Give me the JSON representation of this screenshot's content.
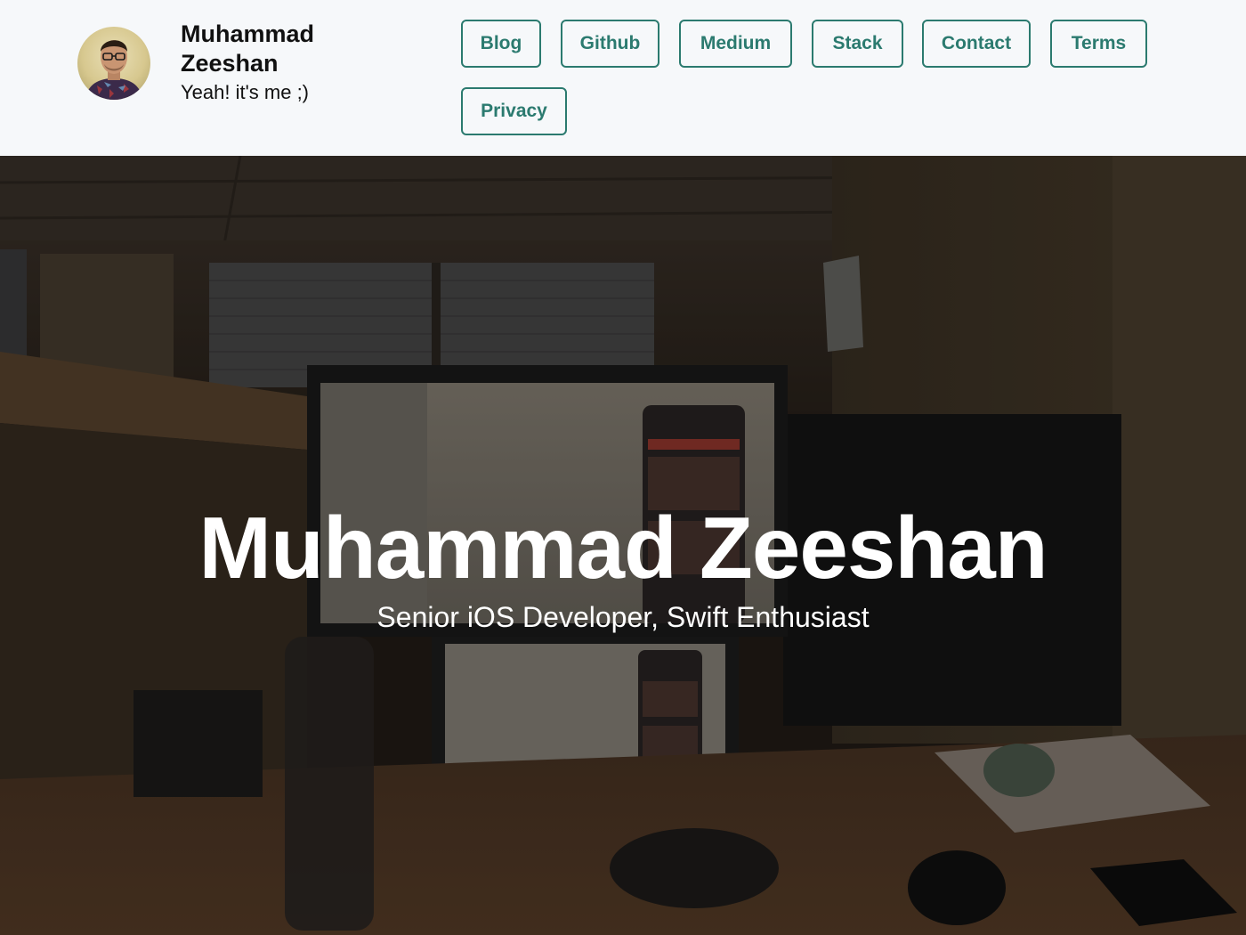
{
  "header": {
    "name": "Muhammad Zeeshan",
    "tagline": "Yeah! it's me ;)",
    "avatar_icon": "profile-photo"
  },
  "nav": {
    "items": [
      {
        "label": "Blog"
      },
      {
        "label": "Github"
      },
      {
        "label": "Medium"
      },
      {
        "label": "Stack"
      },
      {
        "label": "Contact"
      },
      {
        "label": "Terms"
      },
      {
        "label": "Privacy"
      }
    ]
  },
  "hero": {
    "title": "Muhammad Zeeshan",
    "subtitle": "Senior iOS Developer, Swift Enthusiast",
    "background": "dim-office-desk-photo"
  },
  "colors": {
    "accent": "#2b7a6f",
    "header_bg": "#f6f8fa",
    "text": "#111111",
    "hero_text": "#ffffff"
  }
}
